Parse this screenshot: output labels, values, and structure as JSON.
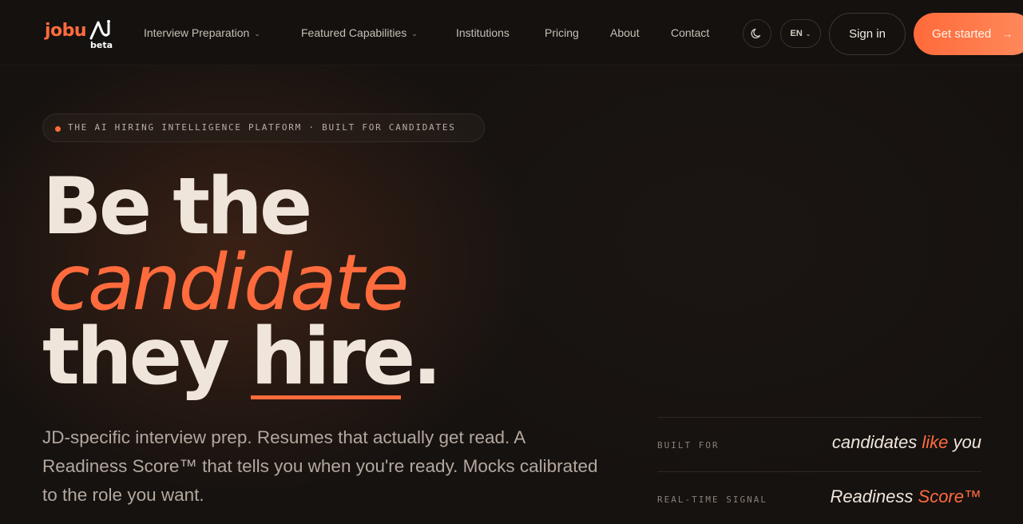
{
  "brand": {
    "logo_text": "jobu",
    "badge": "beta",
    "accent_color": "#ff6b3d"
  },
  "nav": {
    "links": [
      {
        "label": "Interview Preparation",
        "has_dropdown": true
      },
      {
        "label": "Featured Capabilities",
        "has_dropdown": true
      },
      {
        "label": "Institutions",
        "has_dropdown": false
      },
      {
        "label": "Pricing",
        "has_dropdown": false
      },
      {
        "label": "About",
        "has_dropdown": false
      },
      {
        "label": "Contact",
        "has_dropdown": false
      }
    ],
    "theme_toggle_icon": "moon-icon",
    "language": "EN",
    "sign_in_label": "Sign in",
    "get_started_label": "Get started",
    "get_started_arrow": "→"
  },
  "hero": {
    "eyebrow": "THE AI HIRING INTELLIGENCE PLATFORM · BUILT FOR CANDIDATES",
    "headline_line1": "Be the",
    "headline_line2": "candidate",
    "headline_line3_prefix": "they ",
    "headline_line3_underlined": "hire",
    "headline_line3_suffix": ".",
    "lede": "JD-specific interview prep. Resumes that actually get read. A Readiness Score™ that tells you when you're ready. Mocks calibrated to the role you want."
  },
  "stats": [
    {
      "label": "BUILT FOR",
      "value_pre": "candidates ",
      "value_accent": "like",
      "value_post": " you"
    },
    {
      "label": "REAL-TIME SIGNAL",
      "value_pre": "Readiness ",
      "value_accent": "Score™",
      "value_post": ""
    }
  ]
}
